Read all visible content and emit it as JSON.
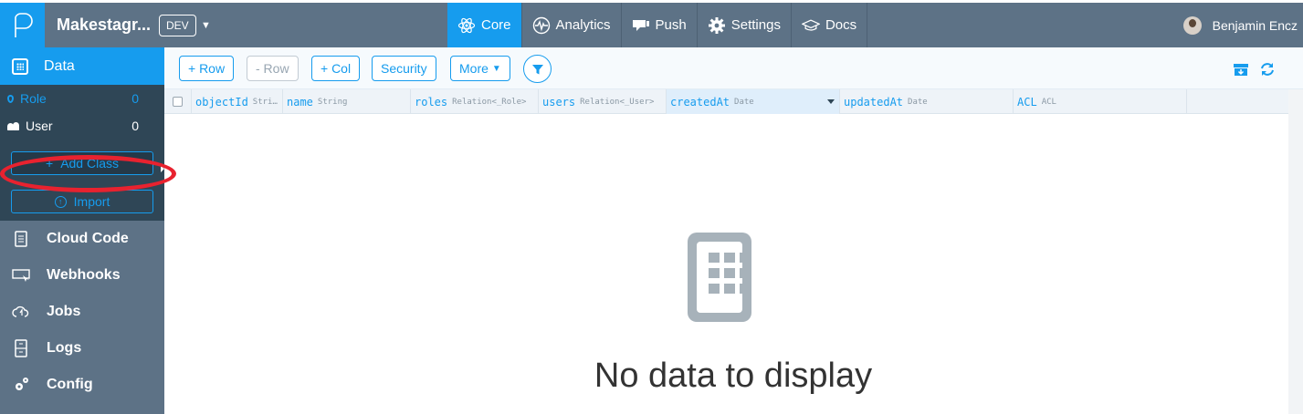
{
  "app": {
    "name": "Makestagr...",
    "env": "DEV"
  },
  "topnav": [
    {
      "label": "Core",
      "icon": "atom-icon",
      "active": true
    },
    {
      "label": "Analytics",
      "icon": "pulse-icon",
      "active": false
    },
    {
      "label": "Push",
      "icon": "megaphone-icon",
      "active": false
    },
    {
      "label": "Settings",
      "icon": "gear-icon",
      "active": false
    },
    {
      "label": "Docs",
      "icon": "graduation-cap-icon",
      "active": false
    }
  ],
  "user": {
    "name": "Benjamin Encz"
  },
  "sidebar": {
    "data_label": "Data",
    "classes": [
      {
        "name": "Role",
        "count": "0",
        "active": true
      },
      {
        "name": "User",
        "count": "0",
        "active": false
      }
    ],
    "add_class_label": "Add Class",
    "import_label": "Import",
    "sections": [
      {
        "label": "Cloud Code",
        "icon": "document-icon"
      },
      {
        "label": "Webhooks",
        "icon": "webhook-icon"
      },
      {
        "label": "Jobs",
        "icon": "cloud-icon"
      },
      {
        "label": "Logs",
        "icon": "logs-icon"
      },
      {
        "label": "Config",
        "icon": "gears-icon"
      }
    ]
  },
  "toolbar": {
    "add_row": "+ Row",
    "remove_row": "- Row",
    "add_col": "+ Col",
    "security": "Security",
    "more": "More"
  },
  "columns": [
    {
      "name": "objectId",
      "type": "Stri…"
    },
    {
      "name": "name",
      "type": "String"
    },
    {
      "name": "roles",
      "type": "Relation<_Role>"
    },
    {
      "name": "users",
      "type": "Relation<_User>"
    },
    {
      "name": "createdAt",
      "type": "Date",
      "sorted": true
    },
    {
      "name": "updatedAt",
      "type": "Date"
    },
    {
      "name": "ACL",
      "type": "ACL"
    }
  ],
  "empty_state": {
    "message": "No data to display"
  },
  "colors": {
    "accent": "#169cee",
    "nav_bg": "#5d7286",
    "sidebar_dark": "#2f4656",
    "annotation": "#e8222f"
  }
}
